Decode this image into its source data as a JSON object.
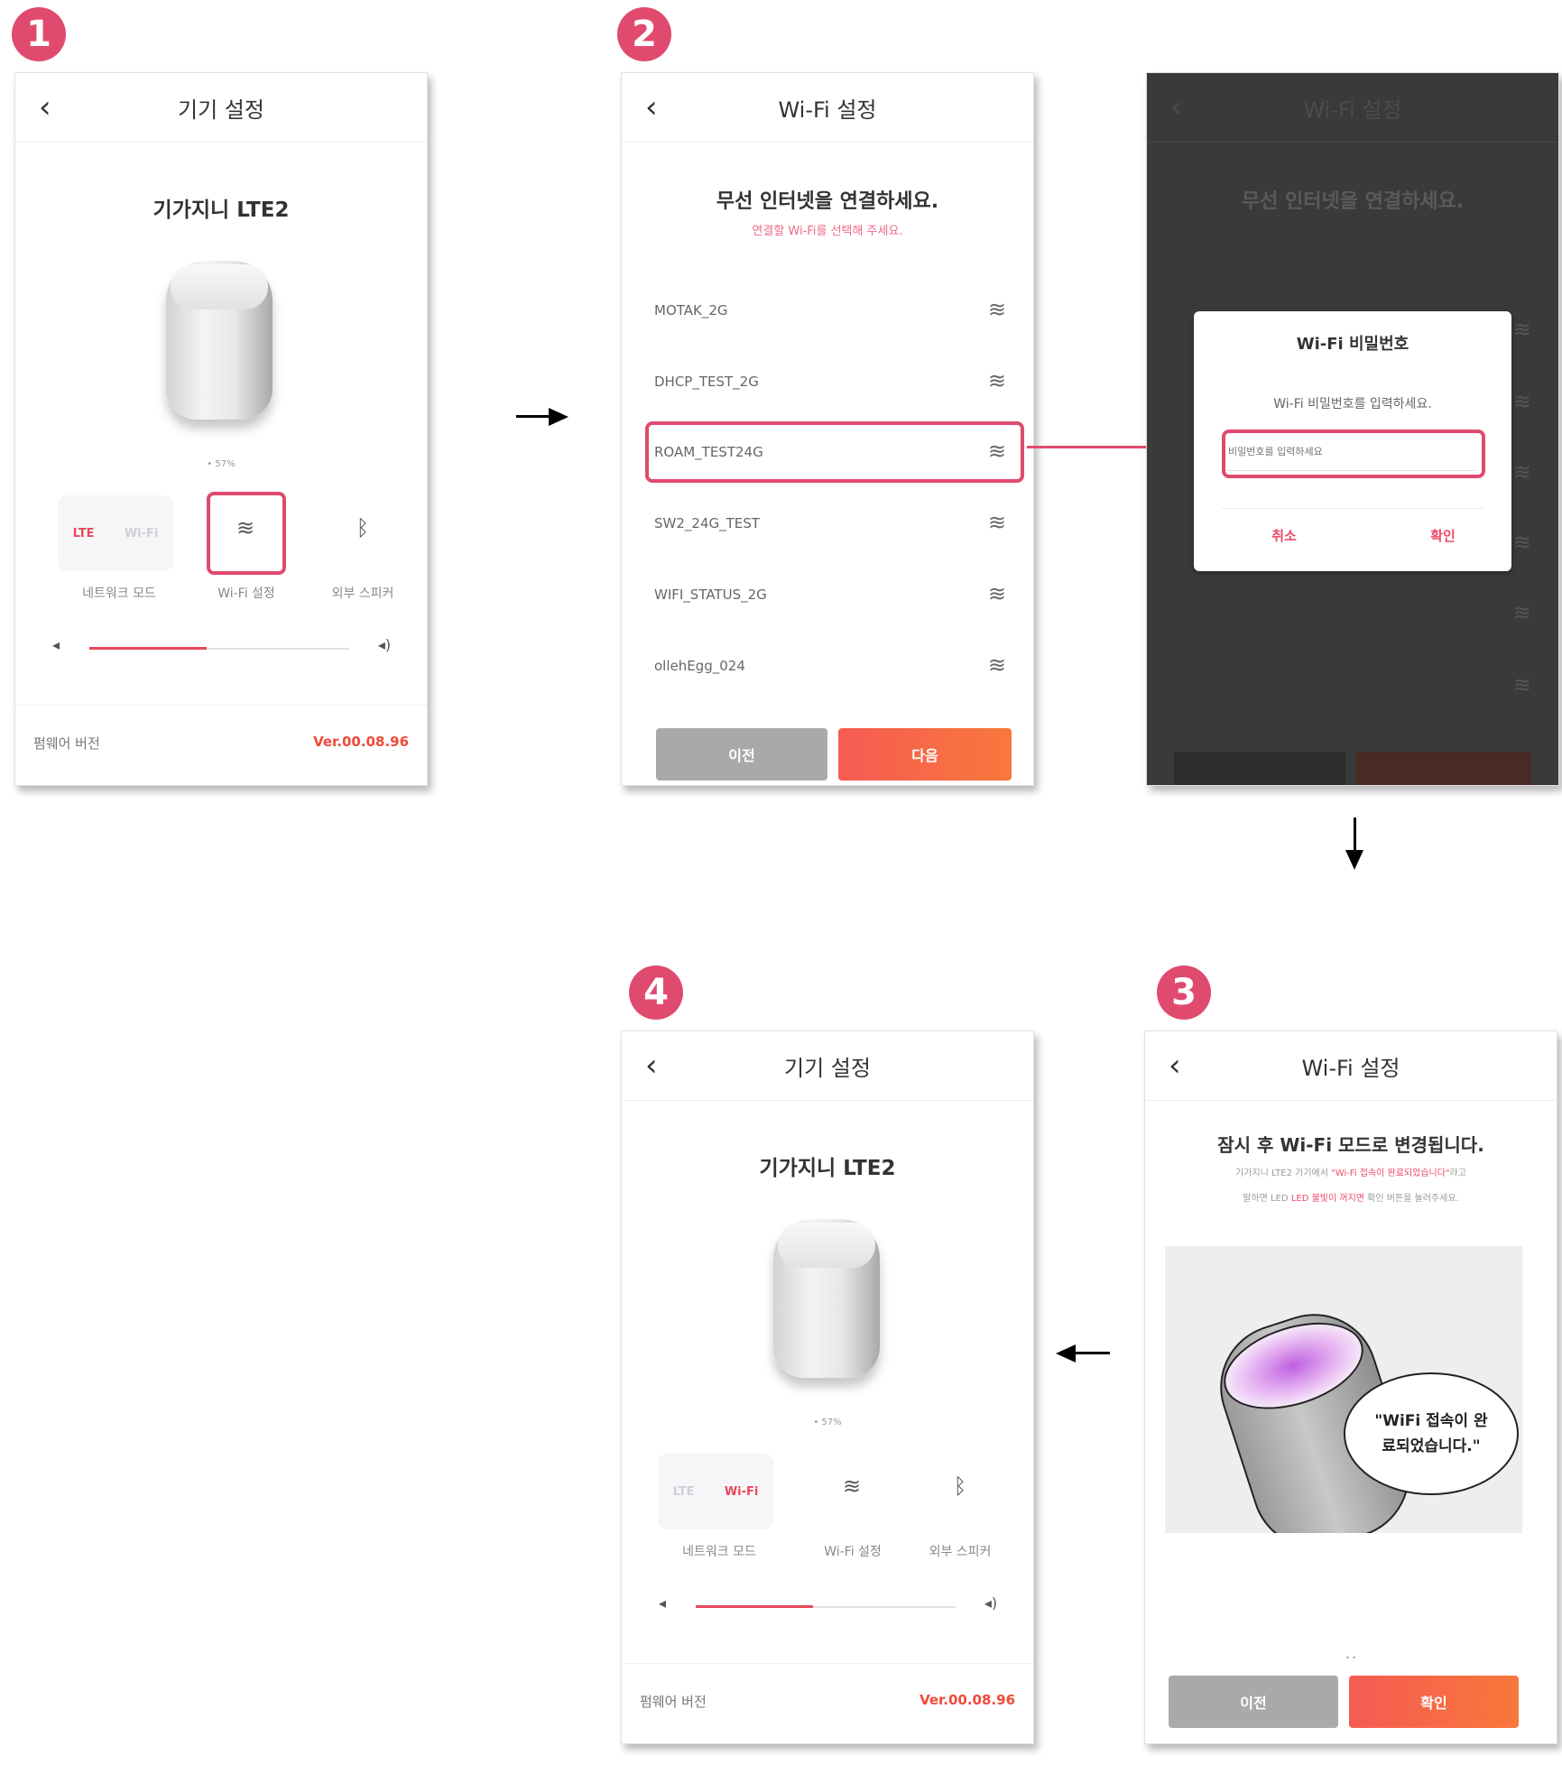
{
  "steps": [
    "1",
    "2",
    "4",
    "3"
  ],
  "screen1": {
    "title": "기기 설정",
    "device_name": "기가지니 LTE2",
    "status_text": "• 57%",
    "mode_lte": "LTE",
    "mode_wifi": "Wi-Fi",
    "caption_network": "네트워크 모드",
    "caption_wifi": "Wi-Fi 설정",
    "caption_speaker": "외부 스피커",
    "firmware_label": "펌웨어 버전",
    "firmware_version": "Ver.00.08.96",
    "volume_level": 0.45
  },
  "screen2": {
    "title": "Wi-Fi 설정",
    "heading": "무선 인터넷을 연결하세요.",
    "subtext": "연결할 Wi-Fi를 선택해 주세요.",
    "networks": [
      "MOTAK_2G",
      "DHCP_TEST_2G",
      "ROAM_TEST24G",
      "SW2_24G_TEST",
      "WIFI_STATUS_2G",
      "ollehEgg_024"
    ],
    "selected_network": "ROAM_TEST24G",
    "prev_label": "이전",
    "next_label": "다음"
  },
  "screen2b": {
    "title": "Wi-Fi 설정",
    "heading": "무선 인터넷을 연결하세요.",
    "dialog_title": "Wi-Fi 비밀번호",
    "dialog_message": "Wi-Fi 비밀번호를 입력하세요.",
    "password_placeholder": "비밀번호를 입력하세요",
    "cancel_label": "취소",
    "ok_label": "확인"
  },
  "screen3": {
    "title": "Wi-Fi 설정",
    "heading": "잠시 후 Wi-Fi 모드로 변경됩니다.",
    "line1_gray": "기가지니 LTE2 기기에서 ",
    "line1_pink": "\"Wi-Fi 접속이 완료되었습니다\"",
    "line1_gray2": "라고",
    "line2_gray": "말하면 LED ",
    "line2_pink": "LED 불빛이 꺼지면",
    "line2_gray2": " 확인 버튼을 눌러주세요.",
    "bubble_text": "\"WiFi 접속이 완료되었습니다.\"",
    "prev_label": "이전",
    "ok_label": "확인"
  },
  "screen4": {
    "title": "기기 설정",
    "device_name": "기가지니 LTE2",
    "status_text": "• 57%",
    "mode_lte": "LTE",
    "mode_wifi": "Wi-Fi",
    "caption_network": "네트워크 모드",
    "caption_wifi": "Wi-Fi 설정",
    "caption_speaker": "외부 스피커",
    "firmware_label": "펌웨어 버전",
    "firmware_version": "Ver.00.08.96",
    "volume_level": 0.45
  },
  "colors": {
    "accent_pink": "#e04a6e",
    "accent_orange": "#f8783c",
    "version_red": "#f04a3a"
  }
}
